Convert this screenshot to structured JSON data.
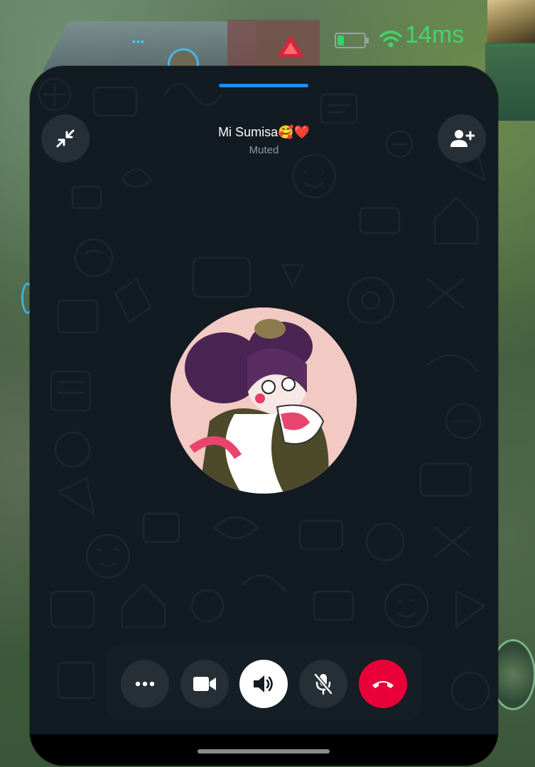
{
  "game_hud": {
    "ping": "14ms",
    "battery_level": 0.25,
    "colors": {
      "ping": "#42d46b",
      "battery": "#2fd36a",
      "team_blue": "#36d3f0"
    }
  },
  "call": {
    "contact_name": "Mi Sumisa",
    "contact_emoji": "🥰",
    "contact_heart": "❤️",
    "status": "Muted",
    "icons": {
      "minimize": "collapse-arrows-icon",
      "add_participant": "add-person-icon",
      "more": "more-options-icon",
      "video": "video-camera-icon",
      "speaker": "speaker-icon",
      "mic": "microphone-off-icon",
      "end": "end-call-icon"
    },
    "colors": {
      "background": "#111b21",
      "button": "#262f35",
      "speaker_active": "#ffffff",
      "end_call": "#ea0038",
      "handle": "#1d8ef0"
    }
  }
}
